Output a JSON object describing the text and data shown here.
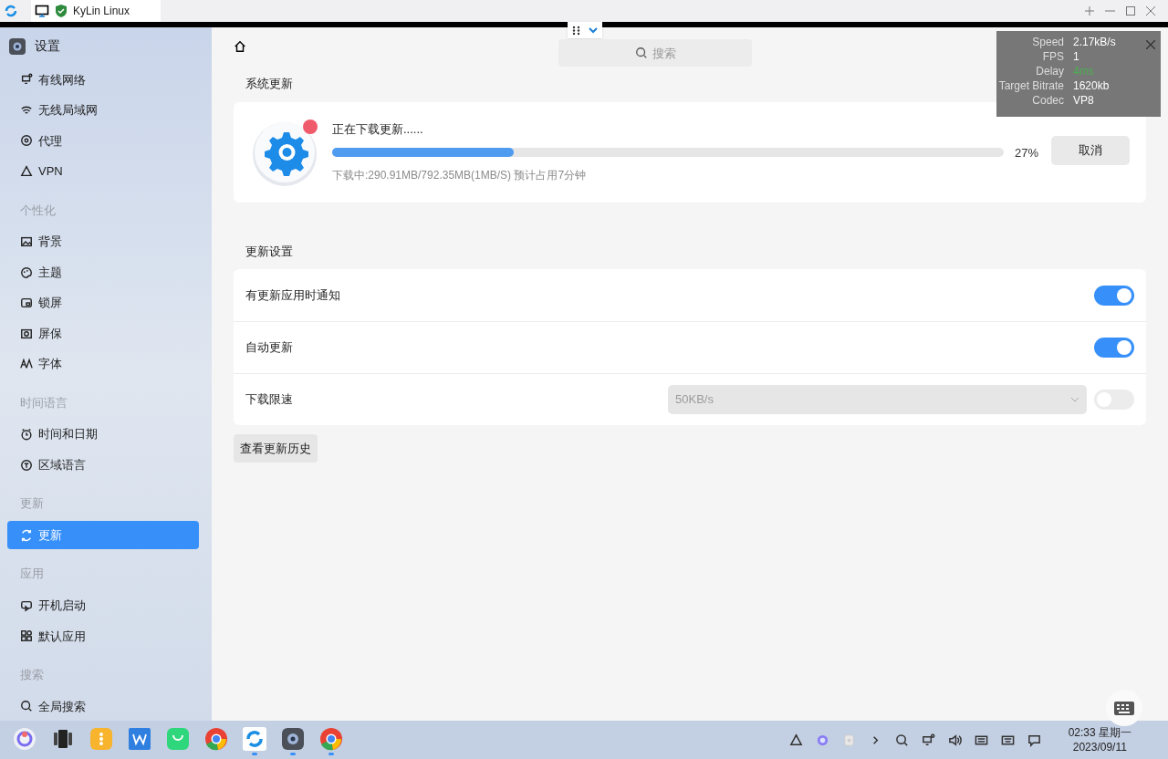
{
  "browser_tab": {
    "title": "KyLin Linux"
  },
  "search": {
    "placeholder": "搜索"
  },
  "stats": [
    {
      "label": "Speed",
      "value": "2.17kB/s",
      "color": "#ffffff"
    },
    {
      "label": "FPS",
      "value": "1",
      "color": "#ffffff"
    },
    {
      "label": "Delay",
      "value": "4ms",
      "color": "#4caf50"
    },
    {
      "label": "Target Bitrate",
      "value": "1620kb",
      "color": "#ffffff"
    },
    {
      "label": "Codec",
      "value": "VP8",
      "color": "#ffffff"
    }
  ],
  "sidebar": {
    "title": "设置",
    "groups": [
      {
        "items": [
          {
            "label": "有线网络",
            "selected": false
          },
          {
            "label": "无线局域网",
            "selected": false
          },
          {
            "label": "代理",
            "selected": false
          },
          {
            "label": "VPN",
            "selected": false
          }
        ]
      },
      {
        "heading": "个性化",
        "items": [
          {
            "label": "背景",
            "selected": false
          },
          {
            "label": "主题",
            "selected": false
          },
          {
            "label": "锁屏",
            "selected": false
          },
          {
            "label": "屏保",
            "selected": false
          },
          {
            "label": "字体",
            "selected": false
          }
        ]
      },
      {
        "heading": "时间语言",
        "items": [
          {
            "label": "时间和日期",
            "selected": false
          },
          {
            "label": "区域语言",
            "selected": false
          }
        ]
      },
      {
        "heading": "更新",
        "items": [
          {
            "label": "更新",
            "selected": true
          }
        ]
      },
      {
        "heading": "应用",
        "items": [
          {
            "label": "开机启动",
            "selected": false
          },
          {
            "label": "默认应用",
            "selected": false
          }
        ]
      },
      {
        "heading": "搜索",
        "items": [
          {
            "label": "全局搜索",
            "selected": false
          }
        ]
      }
    ]
  },
  "update": {
    "title": "系统更新",
    "status": "正在下载更新......",
    "level": 0.27,
    "percent": "27%",
    "detail": "下载中:290.91MB/792.35MB(1MB/S) 预计占用7分钟",
    "cancel": "取消"
  },
  "settings": {
    "title": "更新设置",
    "rows": [
      {
        "kind": "toggle",
        "label": "有更新应用时通知",
        "on": true
      },
      {
        "kind": "toggle",
        "label": "自动更新",
        "on": true
      },
      {
        "kind": "select-toggle",
        "label": "下载限速",
        "value": "50KB/s",
        "disabled": true,
        "on": false
      }
    ]
  },
  "history_button": "查看更新历史",
  "dock": [
    {
      "running": false
    },
    {
      "running": false
    },
    {
      "running": false
    },
    {
      "running": false
    },
    {
      "running": false
    },
    {
      "running": false
    },
    {
      "running": true
    },
    {
      "running": true
    },
    {
      "running": true
    }
  ],
  "clock": {
    "time": "02:33 星期一",
    "date": "2023/09/11"
  }
}
